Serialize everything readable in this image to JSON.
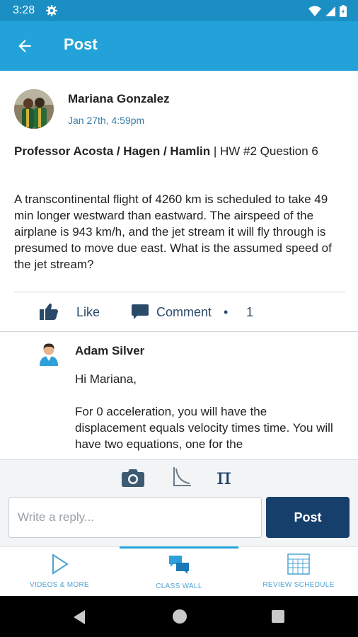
{
  "status_bar": {
    "time": "3:28"
  },
  "app_bar": {
    "title": "Post"
  },
  "post": {
    "author": "Mariana Gonzalez",
    "date": "Jan 27th, 4:59pm",
    "title_bold": "Professor Acosta / Hagen / Hamlin",
    "title_rest": " | HW #2 Question 6",
    "body": "A transcontinental flight of 4260 km is scheduled to take 49 min longer westward than eastward. The airspeed of the airplane is 943 km/h, and the jet stream it will fly through is presumed to move due east. What is the assumed speed of the jet stream?",
    "like_label": "Like",
    "comment_label": "Comment",
    "comment_separator": "•",
    "comment_count": "1"
  },
  "reply": {
    "author": "Adam Silver",
    "body": "Hi Mariana,\n\nFor 0 acceleration, you will have the displacement equals velocity times time. You will have two equations, one for the"
  },
  "composer": {
    "placeholder": "Write a reply...",
    "post_button": "Post",
    "icons": [
      "camera-icon",
      "graph-icon",
      "pi-icon"
    ],
    "pi_symbol": "π"
  },
  "bottom_nav": {
    "items": [
      {
        "label": "VIDEOS & MORE",
        "icon": "play-icon"
      },
      {
        "label": "CLASS WALL",
        "icon": "chat-icon",
        "active": true
      },
      {
        "label": "REVIEW SCHEDULE",
        "icon": "calendar-icon"
      }
    ]
  },
  "colors": {
    "app_bar": "#22a2d8",
    "status_bar": "#1b8fc4",
    "post_button": "#163f6b",
    "accent_text": "#2b4a6a"
  }
}
